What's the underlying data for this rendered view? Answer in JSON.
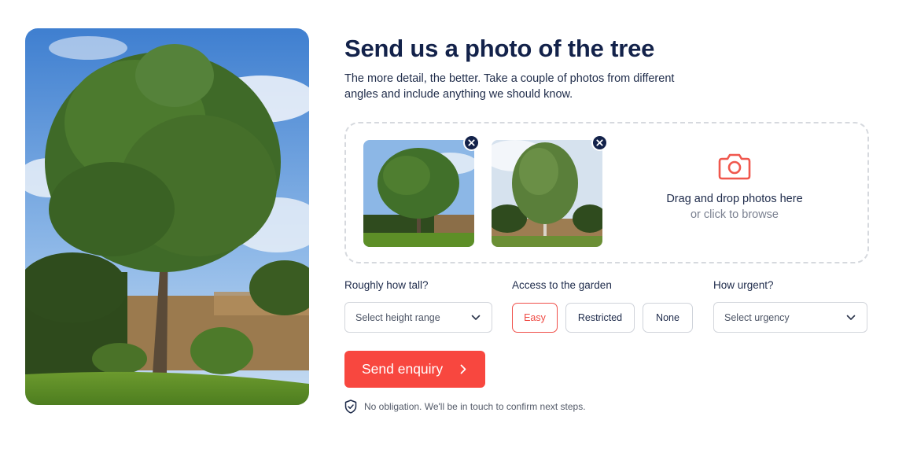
{
  "heading": {
    "title": "Send us a photo of the tree",
    "subtitle": "The more detail, the better. Take a couple of photos from different angles and include anything we should know."
  },
  "upload": {
    "cta_main": "Drag and drop photos here",
    "cta_sub": "or click to browse",
    "icon": "camera-icon"
  },
  "form": {
    "height_label": "Roughly how tall?",
    "height_placeholder": "Select height range",
    "access_label": "Access to the garden",
    "access_options": [
      "Easy",
      "Restricted",
      "None"
    ],
    "access_selected": "Easy",
    "urgency_label": "How urgent?",
    "urgency_placeholder": "Select urgency"
  },
  "submit": {
    "label": "Send enquiry"
  },
  "footer_note": "No obligation. We'll be in touch to confirm next steps.",
  "colors": {
    "accent": "#f8473f",
    "navy": "#13224a",
    "border": "#d3d6dc",
    "dashed_border": "#d6d9de"
  }
}
